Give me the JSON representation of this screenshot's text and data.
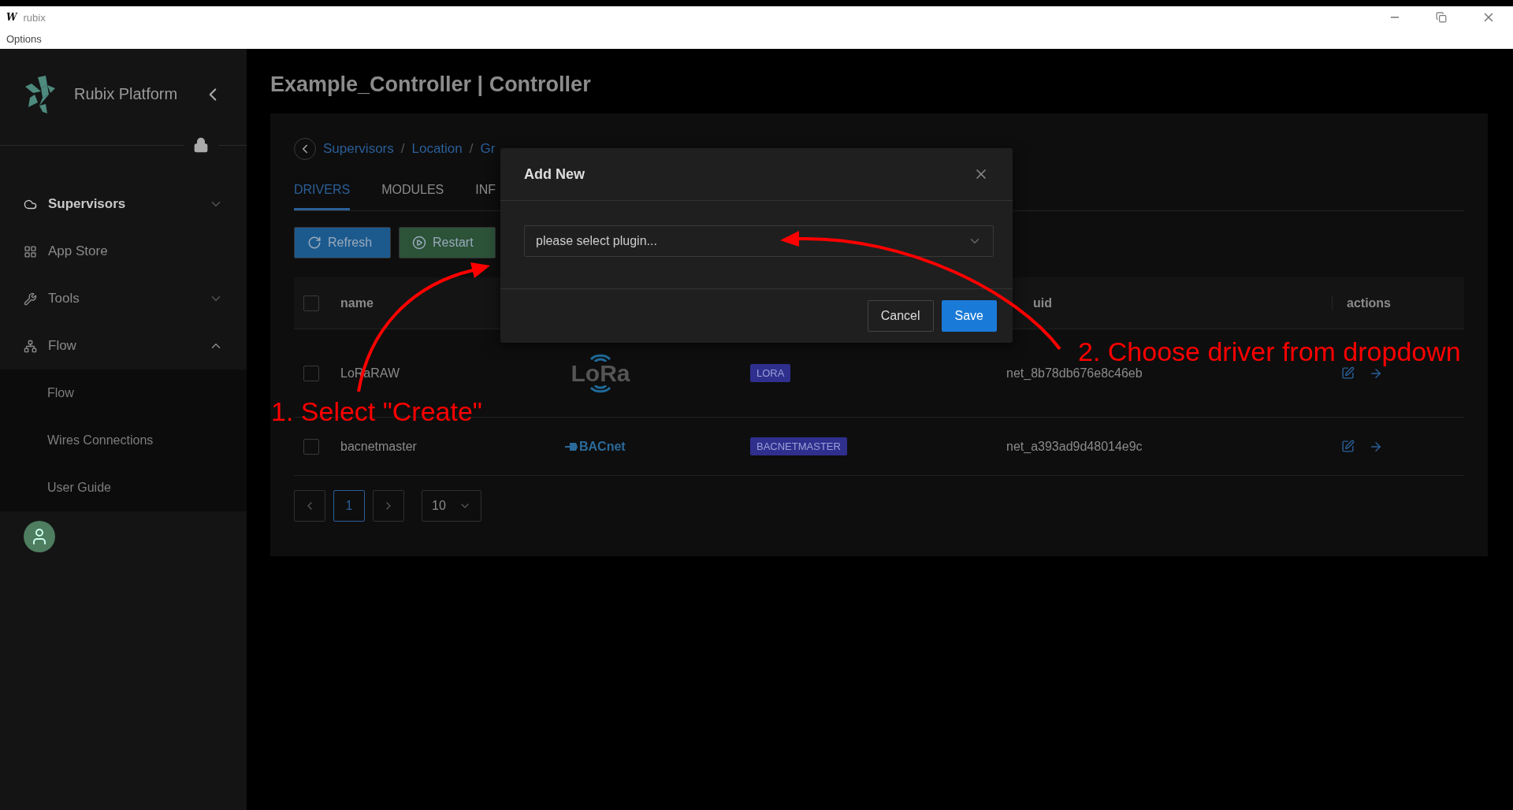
{
  "window": {
    "app_letter": "W",
    "title": "rubix",
    "menu": [
      "Options"
    ]
  },
  "sidebar": {
    "brand": "Rubix Platform",
    "items": [
      {
        "label": "Supervisors",
        "kind": "group",
        "selected": true,
        "expanded": false
      },
      {
        "label": "App Store",
        "kind": "link",
        "selected": false
      },
      {
        "label": "Tools",
        "kind": "group",
        "selected": false,
        "expanded": false
      },
      {
        "label": "Flow",
        "kind": "group",
        "selected": false,
        "expanded": true,
        "children": [
          {
            "label": "Flow"
          },
          {
            "label": "Wires Connections"
          },
          {
            "label": "User Guide"
          }
        ]
      }
    ]
  },
  "page": {
    "title": "Example_Controller | Controller",
    "breadcrumb": [
      {
        "label": "Supervisors"
      },
      {
        "separator": "/",
        "label": "Location"
      },
      {
        "separator": "/",
        "label": "Gr"
      }
    ],
    "tabs": [
      {
        "label": "DRIVERS",
        "selected": true
      },
      {
        "label": "MODULES",
        "selected": false
      },
      {
        "label": "INF",
        "selected": false
      }
    ],
    "buttons": [
      {
        "label": "Refresh",
        "kind": "primary"
      },
      {
        "label": "Restart",
        "kind": "success"
      }
    ],
    "table": {
      "select_all_checked": false,
      "columns": {
        "name": "name",
        "uuid": "uid",
        "actions": "actions"
      },
      "rows": [
        {
          "checked": false,
          "name": "LoRaRAW",
          "logo": {
            "kind": "lora",
            "text": "LoRa"
          },
          "tag": "LORA",
          "uuid": "net_8b78db676e8c46eb"
        },
        {
          "checked": false,
          "name": "bacnetmaster",
          "logo": {
            "kind": "bacnet",
            "text": "BACnet"
          },
          "tag": "BACNETMASTER",
          "uuid": "net_a393ad9d48014e9c"
        }
      ]
    },
    "pagination": {
      "pages": [
        {
          "label": "1",
          "selected": true
        }
      ],
      "page_size": "10"
    }
  },
  "modal": {
    "title": "Add New",
    "select_placeholder": "please select plugin...",
    "buttons": [
      {
        "label": "Cancel",
        "kind": "default"
      },
      {
        "label": "Save",
        "kind": "primary"
      }
    ]
  },
  "annotations": [
    {
      "text": "1. Select \"Create\""
    },
    {
      "text": "2. Choose driver from dropdown"
    }
  ]
}
